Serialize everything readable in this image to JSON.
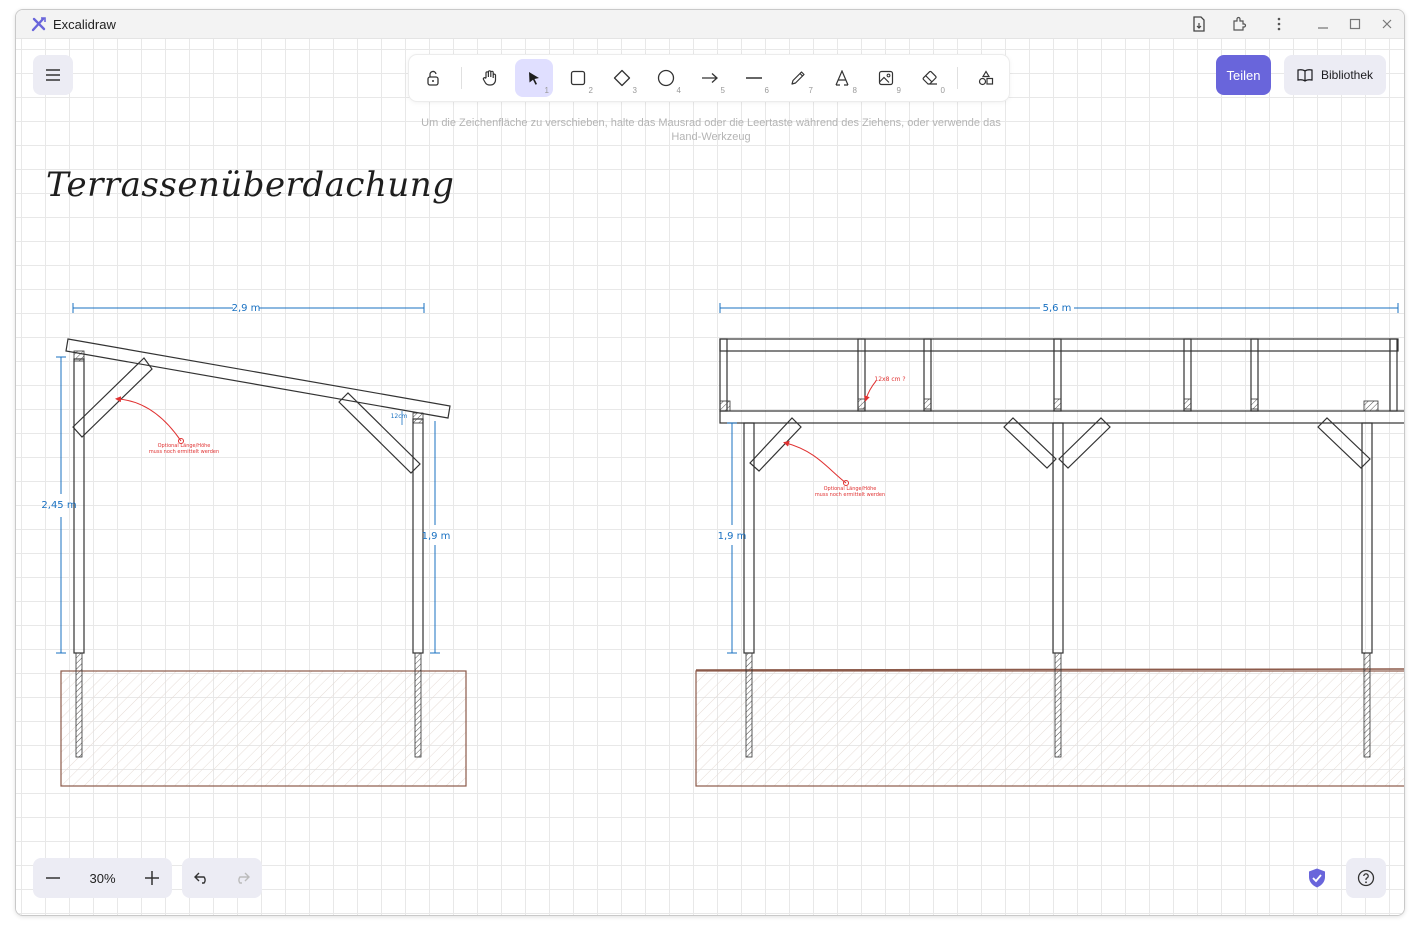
{
  "window": {
    "title": "Excalidraw",
    "icons": [
      "save-to-disk-icon",
      "extension-icon",
      "more-icon",
      "minimize-icon",
      "maximize-icon",
      "close-icon"
    ]
  },
  "toolbar": {
    "tools": [
      {
        "name": "lock",
        "icon": "lock-icon",
        "num": ""
      },
      {
        "name": "hand",
        "icon": "hand-icon",
        "num": ""
      },
      {
        "name": "selection",
        "icon": "pointer-icon",
        "num": "1",
        "active": true
      },
      {
        "name": "rectangle",
        "icon": "rectangle-icon",
        "num": "2"
      },
      {
        "name": "diamond",
        "icon": "diamond-icon",
        "num": "3"
      },
      {
        "name": "ellipse",
        "icon": "ellipse-icon",
        "num": "4"
      },
      {
        "name": "arrow",
        "icon": "arrow-icon",
        "num": "5"
      },
      {
        "name": "line",
        "icon": "line-icon",
        "num": "6"
      },
      {
        "name": "draw",
        "icon": "pencil-icon",
        "num": "7"
      },
      {
        "name": "text",
        "icon": "text-icon",
        "num": "8"
      },
      {
        "name": "image",
        "icon": "image-icon",
        "num": "9"
      },
      {
        "name": "eraser",
        "icon": "eraser-icon",
        "num": "0"
      },
      {
        "name": "more-tools",
        "icon": "shapes-icon",
        "num": ""
      }
    ]
  },
  "hint": {
    "line1": "Um die Zeichenfläche zu verschieben, halte das Mausrad oder die Leertaste während des Ziehens, oder verwende das",
    "line2": "Hand-Werkzeug"
  },
  "header": {
    "share_label": "Teilen",
    "library_label": "Bibliothek"
  },
  "footer": {
    "zoom_value": "30%"
  },
  "drawing": {
    "title": "Terrassenüberdachung",
    "left_view": {
      "width_label": "2,9 m",
      "left_height_label": "2,45 m",
      "right_height_label": "1,9 m",
      "beam_label": "12cm",
      "note_line1": "Optional Länge/Höhe",
      "note_line2": "muss noch ermittelt werden"
    },
    "right_view": {
      "width_label": "5,6 m",
      "height_label": "1,9 m",
      "beam_note": "12x8 cm ?",
      "note_line1": "Optional Länge/Höhe",
      "note_line2": "muss noch ermittelt werden"
    },
    "colors": {
      "dimension": "#1971c2",
      "annotation": "#e03131",
      "ground": "#8c5a4a",
      "stroke": "#1e1e1e"
    }
  }
}
